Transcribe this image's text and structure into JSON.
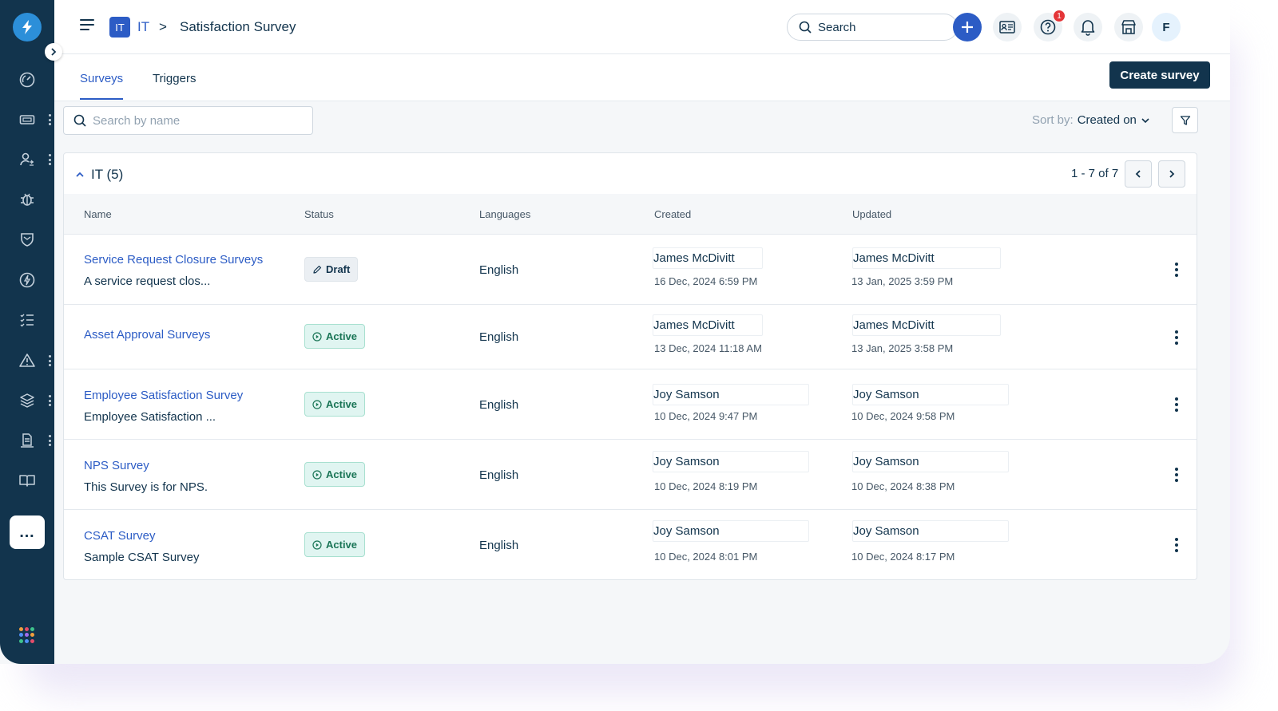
{
  "topbar": {
    "workspace_badge": "IT",
    "workspace_name": "IT",
    "breadcrumb_separator": ">",
    "page_title": "Satisfaction Survey",
    "search_label": "Search",
    "notification_count": "1",
    "avatar_initial": "F"
  },
  "tabs": [
    {
      "label": "Surveys",
      "active": true
    },
    {
      "label": "Triggers",
      "active": false
    }
  ],
  "create_button_label": "Create survey",
  "filter": {
    "search_placeholder": "Search by name",
    "sort_label": "Sort by:",
    "sort_value": "Created on"
  },
  "group": {
    "title": "IT (5)",
    "pagination": "1 - 7 of 7"
  },
  "columns": {
    "name": "Name",
    "status": "Status",
    "languages": "Languages",
    "created": "Created",
    "updated": "Updated"
  },
  "rows": [
    {
      "name": "Service Request Closure Surveys",
      "description": "A service request clos...",
      "status": "Draft",
      "language": "English",
      "created_by": "James McDivitt",
      "created_on": "16 Dec, 2024 6:59 PM",
      "updated_by": "James McDivitt",
      "updated_on": "13 Jan, 2025 3:59 PM"
    },
    {
      "name": "Asset Approval Surveys",
      "description": "",
      "status": "Active",
      "language": "English",
      "created_by": "James McDivitt",
      "created_on": "13 Dec, 2024 11:18 AM",
      "updated_by": "James McDivitt",
      "updated_on": "13 Jan, 2025 3:58 PM"
    },
    {
      "name": "Employee Satisfaction Survey",
      "description": "Employee Satisfaction ...",
      "status": "Active",
      "language": "English",
      "created_by": "Joy Samson",
      "created_on": "10 Dec, 2024 9:47 PM",
      "updated_by": "Joy Samson",
      "updated_on": "10 Dec, 2024 9:58 PM"
    },
    {
      "name": "NPS Survey",
      "description": "This Survey is for NPS.",
      "status": "Active",
      "language": "English",
      "created_by": "Joy Samson",
      "created_on": "10 Dec, 2024 8:19 PM",
      "updated_by": "Joy Samson",
      "updated_on": "10 Dec, 2024 8:38 PM"
    },
    {
      "name": "CSAT Survey",
      "description": "Sample CSAT Survey",
      "status": "Active",
      "language": "English",
      "created_by": "Joy Samson",
      "created_on": "10 Dec, 2024 8:01 PM",
      "updated_by": "Joy Samson",
      "updated_on": "10 Dec, 2024 8:17 PM"
    }
  ],
  "sidebar_icons": [
    "dashboard-icon",
    "tickets-icon",
    "contacts-icon",
    "problems-icon",
    "changes-icon",
    "releases-icon",
    "tasks-icon",
    "alerts-icon",
    "assets-icon",
    "solutions-icon",
    "knowledge-icon",
    "more-icon",
    "apps-icon"
  ],
  "colors": {
    "rail_bg": "#12344d",
    "accent": "#2c5cc5",
    "active_badge": "#1a7556",
    "notification": "#e43538"
  }
}
